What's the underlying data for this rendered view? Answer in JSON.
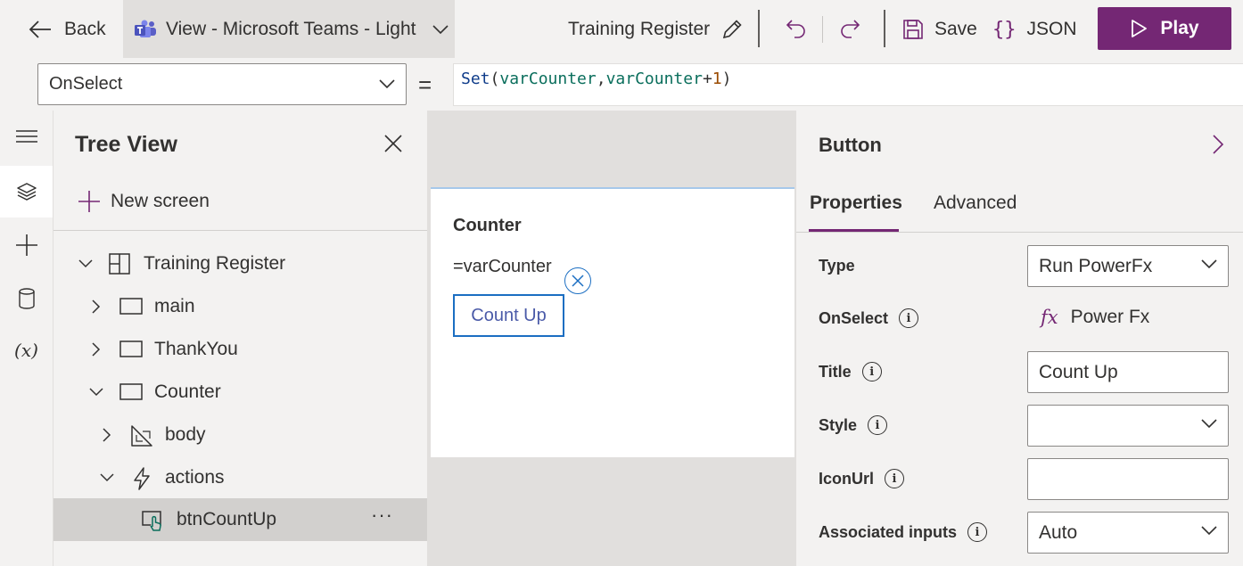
{
  "toolbar": {
    "back_label": "Back",
    "view_label": "View - Microsoft Teams - Light",
    "card_title": "Training Register",
    "save_label": "Save",
    "json_label": "JSON",
    "play_label": "Play"
  },
  "formula_bar": {
    "property": "OnSelect",
    "equals": "=",
    "formula_tokens": [
      "Set",
      "(",
      "varCounter",
      ",",
      "varCounter",
      "+",
      "1",
      ")"
    ]
  },
  "rail": {
    "variables_label": "(x)"
  },
  "tree": {
    "title": "Tree View",
    "new_screen_label": "New screen",
    "items": [
      {
        "label": "Training Register"
      },
      {
        "label": "main"
      },
      {
        "label": "ThankYou"
      },
      {
        "label": "Counter"
      },
      {
        "label": "body"
      },
      {
        "label": "actions"
      },
      {
        "label": "btnCountUp"
      }
    ],
    "more_label": "···"
  },
  "canvas": {
    "card_title": "Counter",
    "text_value": "=varCounter",
    "button_label": "Count Up"
  },
  "properties": {
    "title": "Button",
    "tabs": [
      {
        "label": "Properties"
      },
      {
        "label": "Advanced"
      }
    ],
    "fields": {
      "type_label": "Type",
      "type_value": "Run PowerFx",
      "onselect_label": "OnSelect",
      "onselect_fx": "fx",
      "onselect_value": "Power Fx",
      "title_label": "Title",
      "title_value": "Count Up",
      "style_label": "Style",
      "style_value": "",
      "iconurl_label": "IconUrl",
      "iconurl_value": "",
      "assoc_label": "Associated inputs",
      "assoc_value": "Auto"
    }
  },
  "colors": {
    "accent": "#742774",
    "selected_row": "#d2d0ce",
    "button_border": "#1b6ec2"
  }
}
